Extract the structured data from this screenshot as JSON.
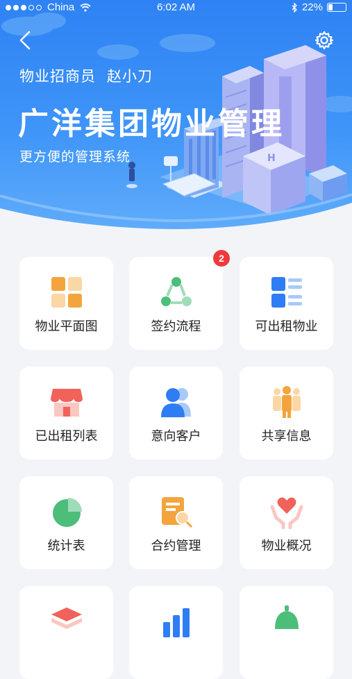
{
  "status_bar": {
    "carrier": "China",
    "time": "6:02 AM",
    "battery": "22%",
    "battery_level": 0.22
  },
  "header": {
    "role": "物业招商员",
    "user_name": "赵小刀",
    "title": "广洋集团物业管理",
    "subtitle": "更方便的管理系统"
  },
  "menu": [
    {
      "label": "物业平面图",
      "icon": "floor-plan-icon"
    },
    {
      "label": "签约流程",
      "icon": "signing-flow-icon",
      "badge": "2"
    },
    {
      "label": "可出租物业",
      "icon": "rentable-list-icon"
    },
    {
      "label": "已出租列表",
      "icon": "storefront-icon"
    },
    {
      "label": "意向客户",
      "icon": "customers-icon"
    },
    {
      "label": "共享信息",
      "icon": "group-share-icon"
    },
    {
      "label": "统计表",
      "icon": "pie-chart-icon"
    },
    {
      "label": "合约管理",
      "icon": "contract-search-icon"
    },
    {
      "label": "物业概况",
      "icon": "heart-hands-icon"
    },
    {
      "label": "",
      "icon": "stack-layers-icon"
    },
    {
      "label": "",
      "icon": "bar-chart-icon"
    },
    {
      "label": "",
      "icon": "service-bell-icon"
    }
  ],
  "colors": {
    "header_blue": "#2e82f4",
    "badge_red": "#ef3a3a",
    "orange": "#f7a13e",
    "green": "#4cbe7a",
    "blue": "#2f7df4",
    "red": "#f0625a"
  }
}
